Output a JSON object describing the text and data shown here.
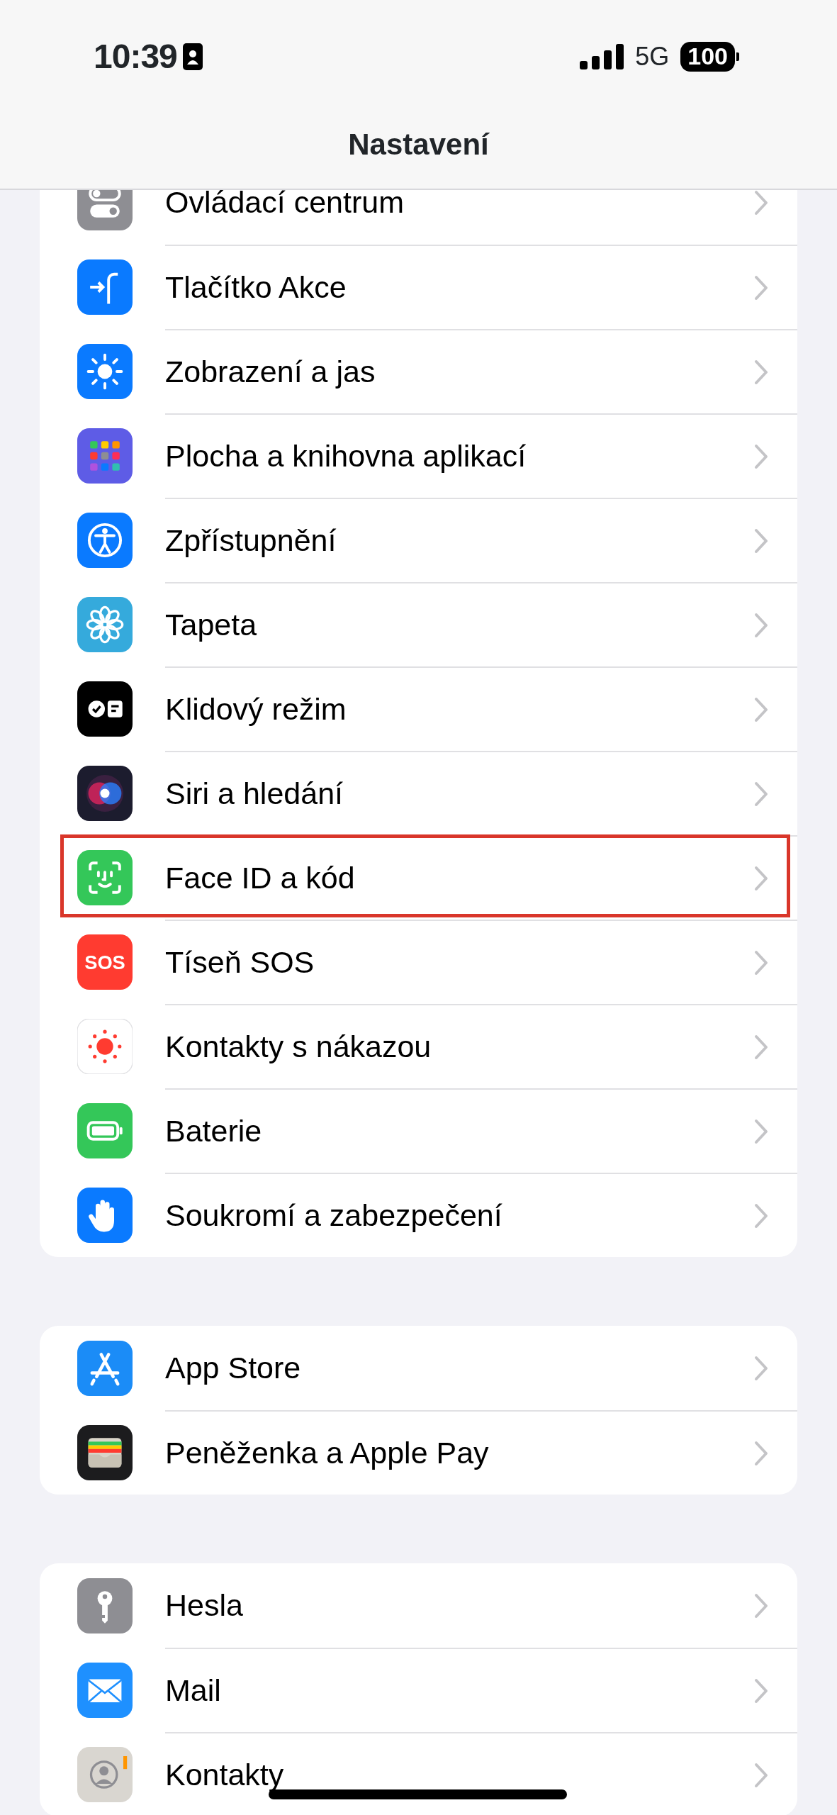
{
  "status_bar": {
    "time": "10:39",
    "network": "5G",
    "battery": "100"
  },
  "navigation_bar": {
    "title": "Nastavení"
  },
  "groups": [
    {
      "items": [
        {
          "kind": "control",
          "label": "Ovládací centrum",
          "highlighted": false
        },
        {
          "kind": "action",
          "label": "Tlačítko Akce",
          "highlighted": false
        },
        {
          "kind": "display",
          "label": "Zobrazení a jas",
          "highlighted": false
        },
        {
          "kind": "homescreen",
          "label": "Plocha a knihovna aplikací",
          "highlighted": false
        },
        {
          "kind": "accessibility",
          "label": "Zpřístupnění",
          "highlighted": false
        },
        {
          "kind": "wallpaper",
          "label": "Tapeta",
          "highlighted": false
        },
        {
          "kind": "standby",
          "label": "Klidový režim",
          "highlighted": false
        },
        {
          "kind": "siri",
          "label": "Siri a hledání",
          "highlighted": false
        },
        {
          "kind": "faceid",
          "label": "Face ID a kód",
          "highlighted": true
        },
        {
          "kind": "sos",
          "label": "Tíseň SOS",
          "icon_text": "SOS",
          "highlighted": false
        },
        {
          "kind": "exposure",
          "label": "Kontakty s nákazou",
          "highlighted": false
        },
        {
          "kind": "battery",
          "label": "Baterie",
          "highlighted": false
        },
        {
          "kind": "privacy",
          "label": "Soukromí a zabezpečení",
          "highlighted": false
        }
      ]
    },
    {
      "items": [
        {
          "kind": "appstore",
          "label": "App Store",
          "highlighted": false
        },
        {
          "kind": "wallet",
          "label": "Peněženka a Apple Pay",
          "highlighted": false
        }
      ]
    },
    {
      "items": [
        {
          "kind": "passwords",
          "label": "Hesla",
          "highlighted": false
        },
        {
          "kind": "mail",
          "label": "Mail",
          "highlighted": false
        },
        {
          "kind": "contacts",
          "label": "Kontakty",
          "highlighted": false
        }
      ]
    }
  ]
}
